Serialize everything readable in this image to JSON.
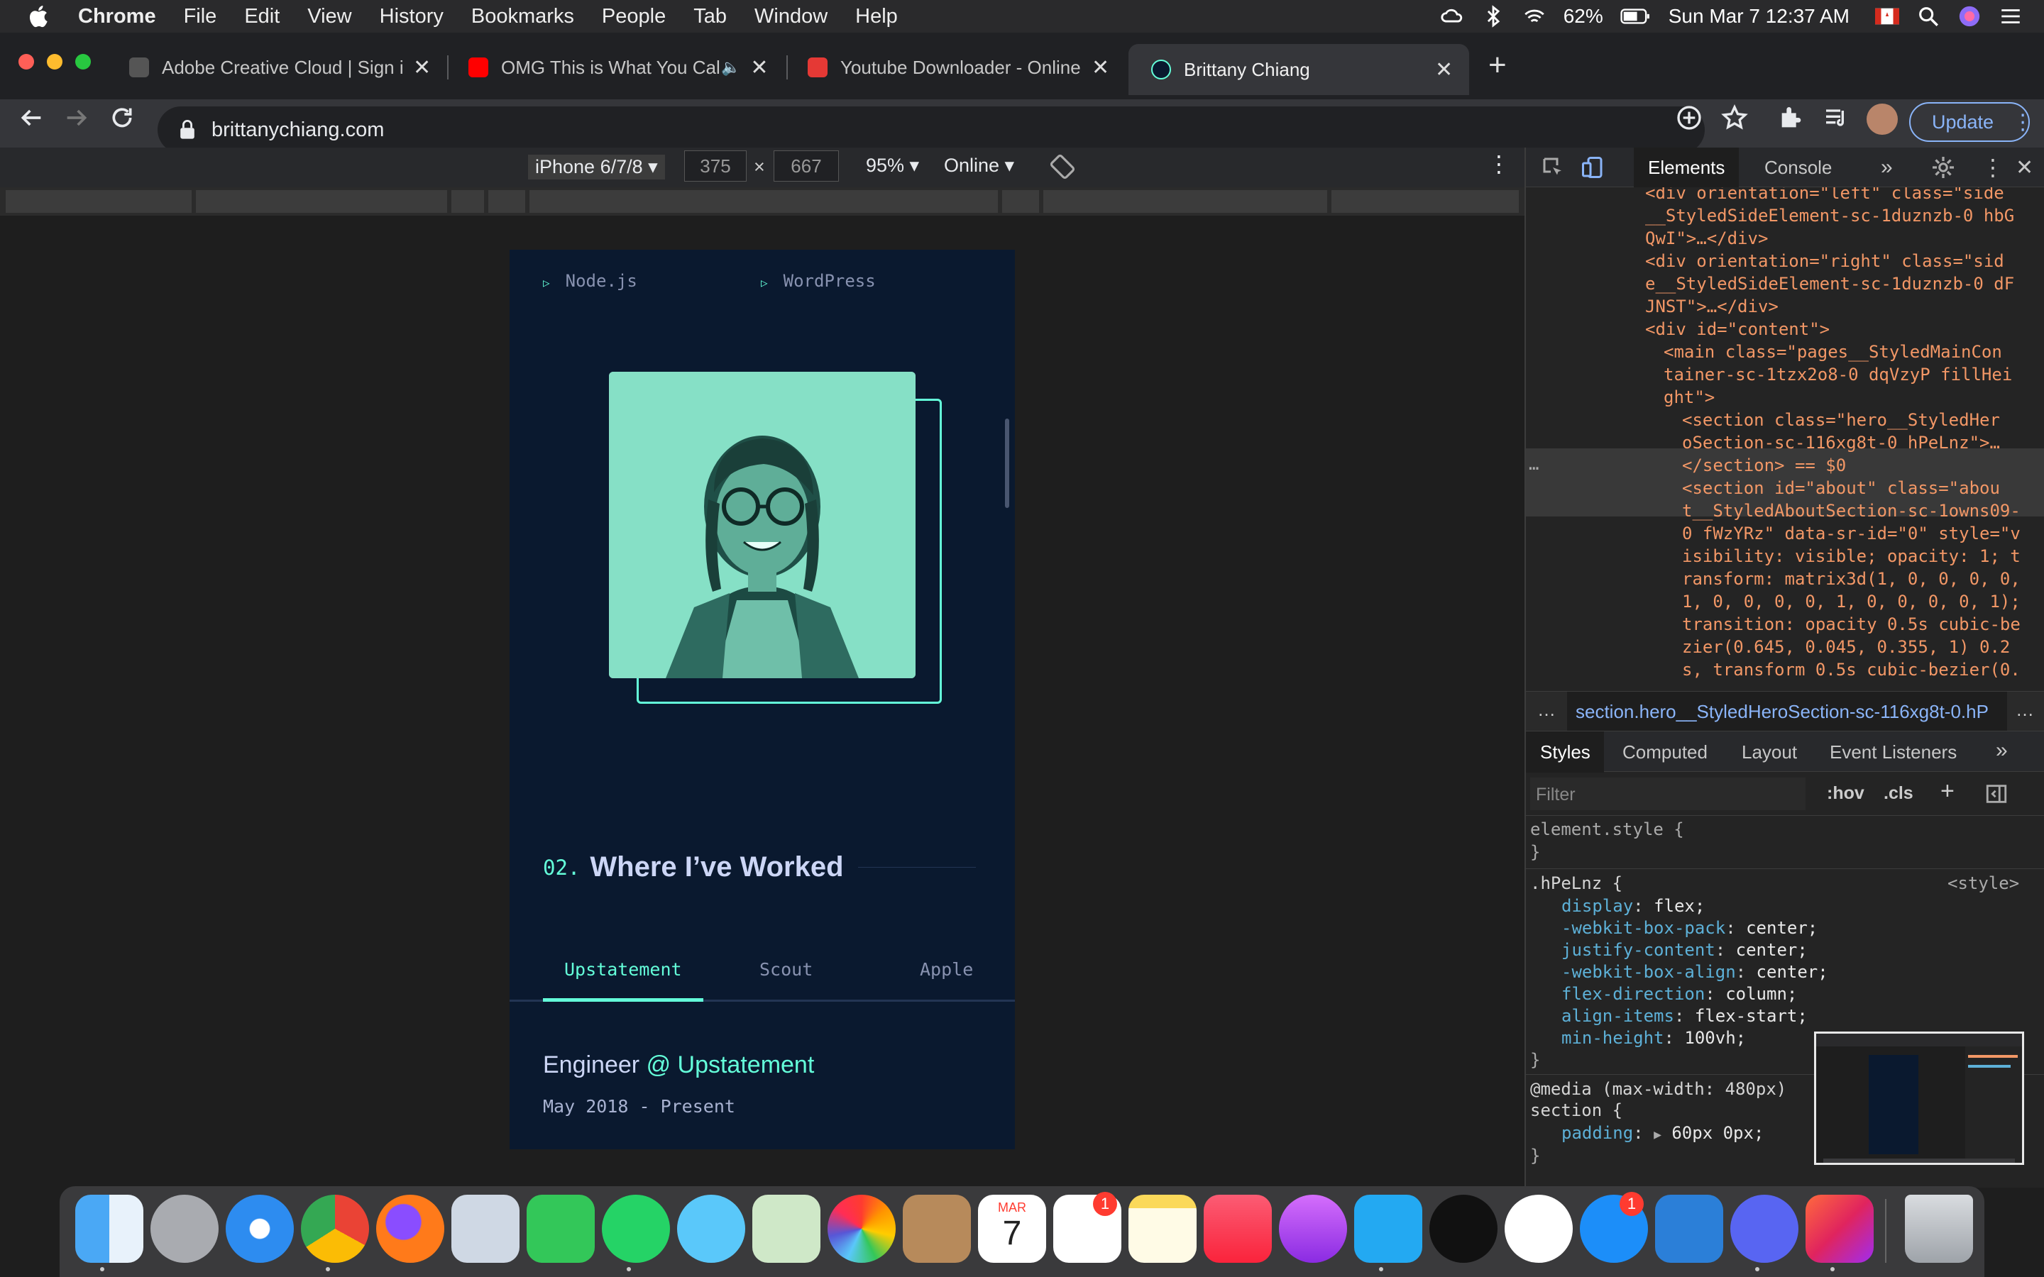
{
  "menubar": {
    "app": "Chrome",
    "items": [
      "File",
      "Edit",
      "View",
      "History",
      "Bookmarks",
      "People",
      "Tab",
      "Window",
      "Help"
    ],
    "battery": "62%",
    "datetime": "Sun Mar 7  12:37 AM"
  },
  "tabs": [
    {
      "title": "Adobe Creative Cloud | Sign in",
      "favicon_color": "#555555"
    },
    {
      "title": "OMG This is What You Call",
      "favicon_color": "#ff0000"
    },
    {
      "title": "Youtube Downloader - Online Y",
      "favicon_color": "#e53935"
    },
    {
      "title": "Brittany Chiang",
      "favicon_color": "#0a192f"
    }
  ],
  "new_tab": "+",
  "omnibox": {
    "url": "brittanychiang.com"
  },
  "update_label": "Update",
  "device_toolbar": {
    "device": "iPhone 6/7/8",
    "width": "375",
    "height": "667",
    "x": "×",
    "zoom": "95%",
    "network": "Online"
  },
  "site": {
    "skills": [
      "Node.js",
      "WordPress"
    ],
    "section_number": "02.",
    "section_title": "Where I’ve Worked",
    "job_tabs": [
      "Upstatement",
      "Scout",
      "Apple"
    ],
    "job_role": "Engineer",
    "job_at": "@ Upstatement",
    "job_dates": "May 2018 - Present",
    "accent": "#64ffda",
    "background": "#0a192f"
  },
  "devtools": {
    "tabs": [
      "Elements",
      "Console"
    ],
    "more": "»",
    "dom_lines": [
      "<div orientation=\"left\" class=\"side",
      "__StyledSideElement-sc-1duznzb-0 hbG",
      "QwI\">…</div>",
      "<div orientation=\"right\" class=\"sid",
      "e__StyledSideElement-sc-1duznzb-0 dF",
      "JNST\">…</div>",
      "<div id=\"content\">",
      "<main class=\"pages__StyledMainCon",
      "tainer-sc-1tzx2o8-0 dqVzyP fillHei",
      "ght\">",
      "<section class=\"hero__StyledHer",
      "oSection-sc-116xg8t-0 hPeLnz\">…",
      "</section> == $0",
      "<section id=\"about\" class=\"abou",
      "t__StyledAboutSection-sc-1owns09-",
      "0 fWzYRz\" data-sr-id=\"0\" style=\"v",
      "isibility: visible; opacity: 1; t",
      "ransform: matrix3d(1, 0, 0, 0, 0,",
      "1, 0, 0, 0, 0, 1, 0, 0, 0, 0, 1);",
      "transition: opacity 0.5s cubic-be",
      "zier(0.645, 0.045, 0.355, 1) 0.2",
      "s, transform 0.5s cubic-bezier(0."
    ],
    "breadcrumb": "section.hero__StyledHeroSection-sc-116xg8t-0.hP",
    "style_tabs": [
      "Styles",
      "Computed",
      "Layout",
      "Event Listeners"
    ],
    "filter_placeholder": "Filter",
    "hov": ":hov",
    "cls": ".cls",
    "element_style": "element.style {",
    "close_brace": "}",
    "rule_selector": ".hPeLnz {",
    "rule_source": "<style>",
    "rule_props": [
      {
        "name": "display",
        "value": "flex;"
      },
      {
        "name": "-webkit-box-pack",
        "value": "center;"
      },
      {
        "name": "justify-content",
        "value": "center;"
      },
      {
        "name": "-webkit-box-align",
        "value": "center;"
      },
      {
        "name": "flex-direction",
        "value": "column;"
      },
      {
        "name": "align-items",
        "value": "flex-start;"
      },
      {
        "name": "min-height",
        "value": "100vh;"
      }
    ],
    "media_query": "@media (max-width: 480px)",
    "media_selector": "section {",
    "media_prop": "padding",
    "media_value": "60px 0px;"
  },
  "dock": {
    "apps": [
      "Finder",
      "Launchpad",
      "Safari",
      "Chrome",
      "Firefox",
      "Preview",
      "FaceTime",
      "WhatsApp",
      "Messages",
      "Maps",
      "Photos",
      "Contacts",
      "Calendar",
      "Reminders",
      "Notes",
      "Music",
      "Podcasts",
      "VS Code",
      "Apple TV",
      "News",
      "App Store",
      "Screenshot",
      "Discord",
      "Creative Cloud",
      "Trash"
    ],
    "calendar_month": "MAR",
    "calendar_day": "7",
    "reminders_badge": "1",
    "appstore_badge": "1"
  }
}
